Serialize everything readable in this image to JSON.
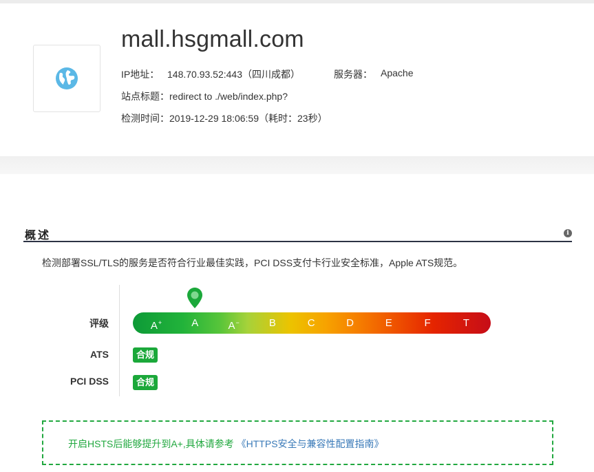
{
  "header": {
    "domain": "mall.hsgmall.com",
    "ip_label": "IP地址：",
    "ip_value": "148.70.93.52:443（四川成都）",
    "server_label": "服务器：",
    "server_value": "Apache",
    "site_title_label": "站点标题：",
    "site_title_value": "redirect to ./web/index.php?",
    "check_time_label": "检测时间：",
    "check_time_value": "2019-12-29 18:06:59（耗时：23秒）",
    "site_icon": "globe-icon"
  },
  "overview": {
    "title": "概述",
    "description": "检测部署SSL/TLS的服务是否符合行业最佳实践，PCI DSS支付卡行业安全标准，Apple ATS规范。",
    "info_icon": "info-icon",
    "rows": {
      "grade_label": "评级",
      "ats_label": "ATS",
      "pci_label": "PCI DSS"
    },
    "grades": [
      {
        "base": "A",
        "mod": "+"
      },
      {
        "base": "A",
        "mod": ""
      },
      {
        "base": "A",
        "mod": "−"
      },
      {
        "base": "B",
        "mod": ""
      },
      {
        "base": "C",
        "mod": ""
      },
      {
        "base": "D",
        "mod": ""
      },
      {
        "base": "E",
        "mod": ""
      },
      {
        "base": "F",
        "mod": ""
      },
      {
        "base": "T",
        "mod": ""
      }
    ],
    "current_grade_index": 1,
    "ats_status": "合规",
    "pci_status": "合规",
    "colors": {
      "compliant": "#1ba83a",
      "tip": "#21a83f",
      "link": "#3a7ab8"
    }
  },
  "tip": {
    "text": "开启HSTS后能够提升到A+,具体请参考",
    "link": "《HTTPS安全与兼容性配置指南》"
  }
}
